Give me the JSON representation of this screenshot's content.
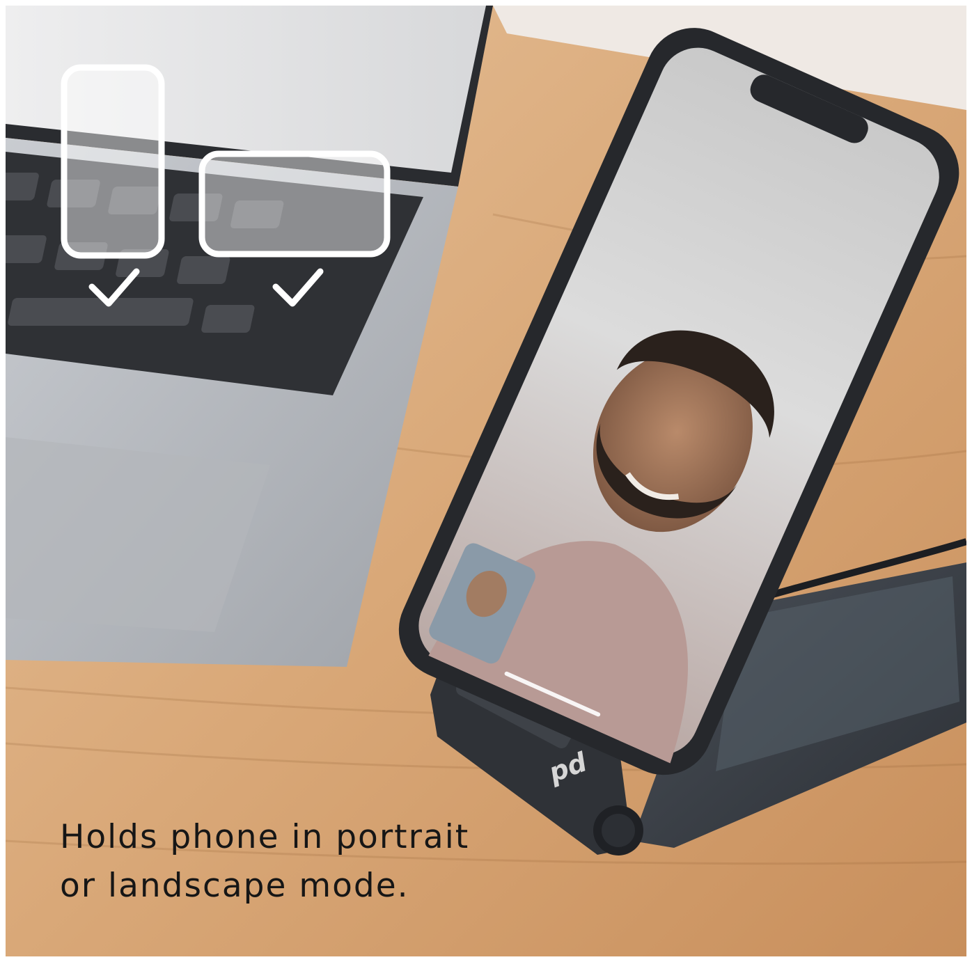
{
  "caption": {
    "line1": "Holds phone in portrait",
    "line2": "or landscape mode."
  },
  "orientation_icons": [
    {
      "name": "portrait",
      "checked": true
    },
    {
      "name": "landscape",
      "checked": true
    }
  ],
  "colors": {
    "wood": "#d9aa7b",
    "laptop": "#b9bcc1",
    "stand": "#3a3d42",
    "phone_case": "#2a2c30",
    "icon_outline": "#ffffff",
    "caption_text": "#161616"
  }
}
